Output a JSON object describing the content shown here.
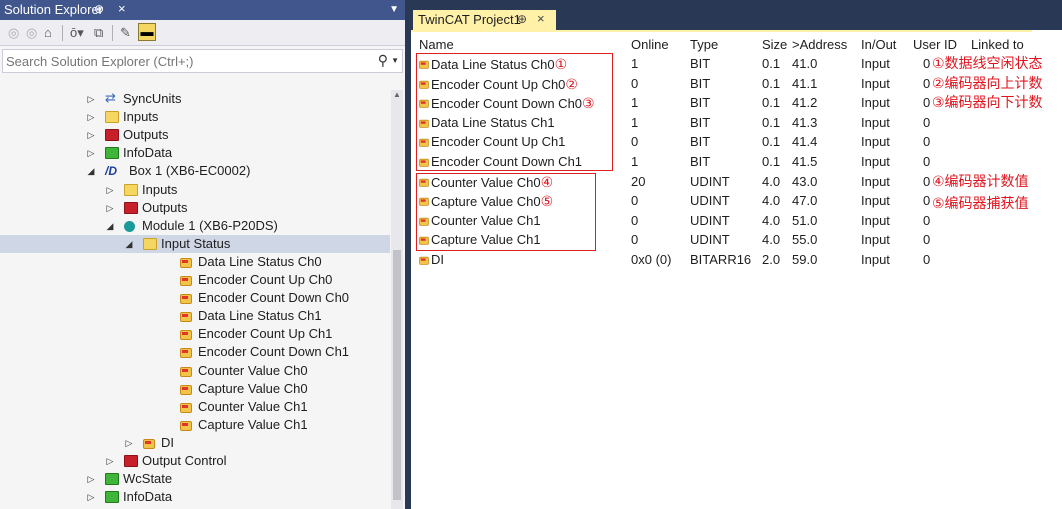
{
  "solution_explorer": {
    "title": "Solution Explorer",
    "pin_glyph": "⊕",
    "close_glyph": "×",
    "search_placeholder": "Search Solution Explorer (Ctrl+;)",
    "tree": [
      {
        "label": "SyncUnits",
        "icon": "sync-icon",
        "expander": "▷"
      },
      {
        "label": "Inputs",
        "icon": "folder-yellow-icon",
        "expander": "▷"
      },
      {
        "label": "Outputs",
        "icon": "folder-red-icon",
        "expander": "▷"
      },
      {
        "label": "InfoData",
        "icon": "folder-green-icon",
        "expander": "▷"
      },
      {
        "label": "Box 1 (XB6-EC0002)",
        "icon": "box-icon",
        "expander": "◢"
      },
      {
        "label": "Inputs",
        "icon": "folder-yellow-icon",
        "expander": "▷"
      },
      {
        "label": "Outputs",
        "icon": "folder-red-icon",
        "expander": "▷"
      },
      {
        "label": "Module 1 (XB6-P20DS)",
        "icon": "module-icon",
        "expander": "◢"
      },
      {
        "label": "Input Status",
        "icon": "folder-yellow-icon",
        "expander": "◢"
      },
      {
        "label": "Data Line Status Ch0",
        "icon": "variable-icon",
        "expander": ""
      },
      {
        "label": "Encoder Count Up Ch0",
        "icon": "variable-icon",
        "expander": ""
      },
      {
        "label": "Encoder Count Down Ch0",
        "icon": "variable-icon",
        "expander": ""
      },
      {
        "label": "Data Line Status Ch1",
        "icon": "variable-icon",
        "expander": ""
      },
      {
        "label": "Encoder Count Up Ch1",
        "icon": "variable-icon",
        "expander": ""
      },
      {
        "label": "Encoder Count Down Ch1",
        "icon": "variable-icon",
        "expander": ""
      },
      {
        "label": "Counter Value Ch0",
        "icon": "variable-icon",
        "expander": ""
      },
      {
        "label": "Capture Value Ch0",
        "icon": "variable-icon",
        "expander": ""
      },
      {
        "label": "Counter Value Ch1",
        "icon": "variable-icon",
        "expander": ""
      },
      {
        "label": "Capture Value Ch1",
        "icon": "variable-icon",
        "expander": ""
      },
      {
        "label": "DI",
        "icon": "variable-icon",
        "expander": "▷"
      },
      {
        "label": "Output Control",
        "icon": "folder-red-icon",
        "expander": "▷"
      },
      {
        "label": "WcState",
        "icon": "folder-green-icon",
        "expander": "▷"
      },
      {
        "label": "InfoData",
        "icon": "folder-green-icon",
        "expander": "▷"
      }
    ]
  },
  "document": {
    "tab_title": "TwinCAT Project1",
    "pin_glyph": "⊕",
    "close_glyph": "×",
    "columns": [
      "Name",
      "Online",
      "Type",
      "Size",
      ">Address",
      "In/Out",
      "User ID",
      "Linked to"
    ],
    "rows": [
      {
        "name": "Data Line Status Ch0",
        "marker": "①",
        "online": "1",
        "type": "BIT",
        "size": "0.1",
        "address": "41.0",
        "inout": "Input",
        "userid": "0",
        "note": "①数据线空闲状态"
      },
      {
        "name": "Encoder Count Up Ch0",
        "marker": "②",
        "online": "0",
        "type": "BIT",
        "size": "0.1",
        "address": "41.1",
        "inout": "Input",
        "userid": "0",
        "note": "②编码器向上计数"
      },
      {
        "name": "Encoder Count Down Ch0",
        "marker": "③",
        "online": "1",
        "type": "BIT",
        "size": "0.1",
        "address": "41.2",
        "inout": "Input",
        "userid": "0",
        "note": "③编码器向下计数"
      },
      {
        "name": "Data Line Status Ch1",
        "marker": "",
        "online": "1",
        "type": "BIT",
        "size": "0.1",
        "address": "41.3",
        "inout": "Input",
        "userid": "0",
        "note": ""
      },
      {
        "name": "Encoder Count Up Ch1",
        "marker": "",
        "online": "0",
        "type": "BIT",
        "size": "0.1",
        "address": "41.4",
        "inout": "Input",
        "userid": "0",
        "note": ""
      },
      {
        "name": "Encoder Count Down Ch1",
        "marker": "",
        "online": "1",
        "type": "BIT",
        "size": "0.1",
        "address": "41.5",
        "inout": "Input",
        "userid": "0",
        "note": ""
      },
      {
        "name": "Counter Value Ch0",
        "marker": "④",
        "online": "20",
        "type": "UDINT",
        "size": "4.0",
        "address": "43.0",
        "inout": "Input",
        "userid": "0",
        "note": "④编码器计数值"
      },
      {
        "name": "Capture Value Ch0",
        "marker": "⑤",
        "online": "0",
        "type": "UDINT",
        "size": "4.0",
        "address": "47.0",
        "inout": "Input",
        "userid": "0",
        "note": "⑤编码器捕获值"
      },
      {
        "name": "Counter Value Ch1",
        "marker": "",
        "online": "0",
        "type": "UDINT",
        "size": "4.0",
        "address": "51.0",
        "inout": "Input",
        "userid": "0",
        "note": ""
      },
      {
        "name": "Capture Value Ch1",
        "marker": "",
        "online": "0",
        "type": "UDINT",
        "size": "4.0",
        "address": "55.0",
        "inout": "Input",
        "userid": "0",
        "note": ""
      },
      {
        "name": "DI",
        "marker": "",
        "online": "0x0 (0)",
        "type": "BITARR16",
        "size": "2.0",
        "address": "59.0",
        "inout": "Input",
        "userid": "0",
        "note": ""
      }
    ]
  },
  "colors": {
    "title_bar": "#40568d",
    "doc_tab": "#fff1a8",
    "selection": "#cfd6e5",
    "annotation_red": "#e0141e"
  }
}
